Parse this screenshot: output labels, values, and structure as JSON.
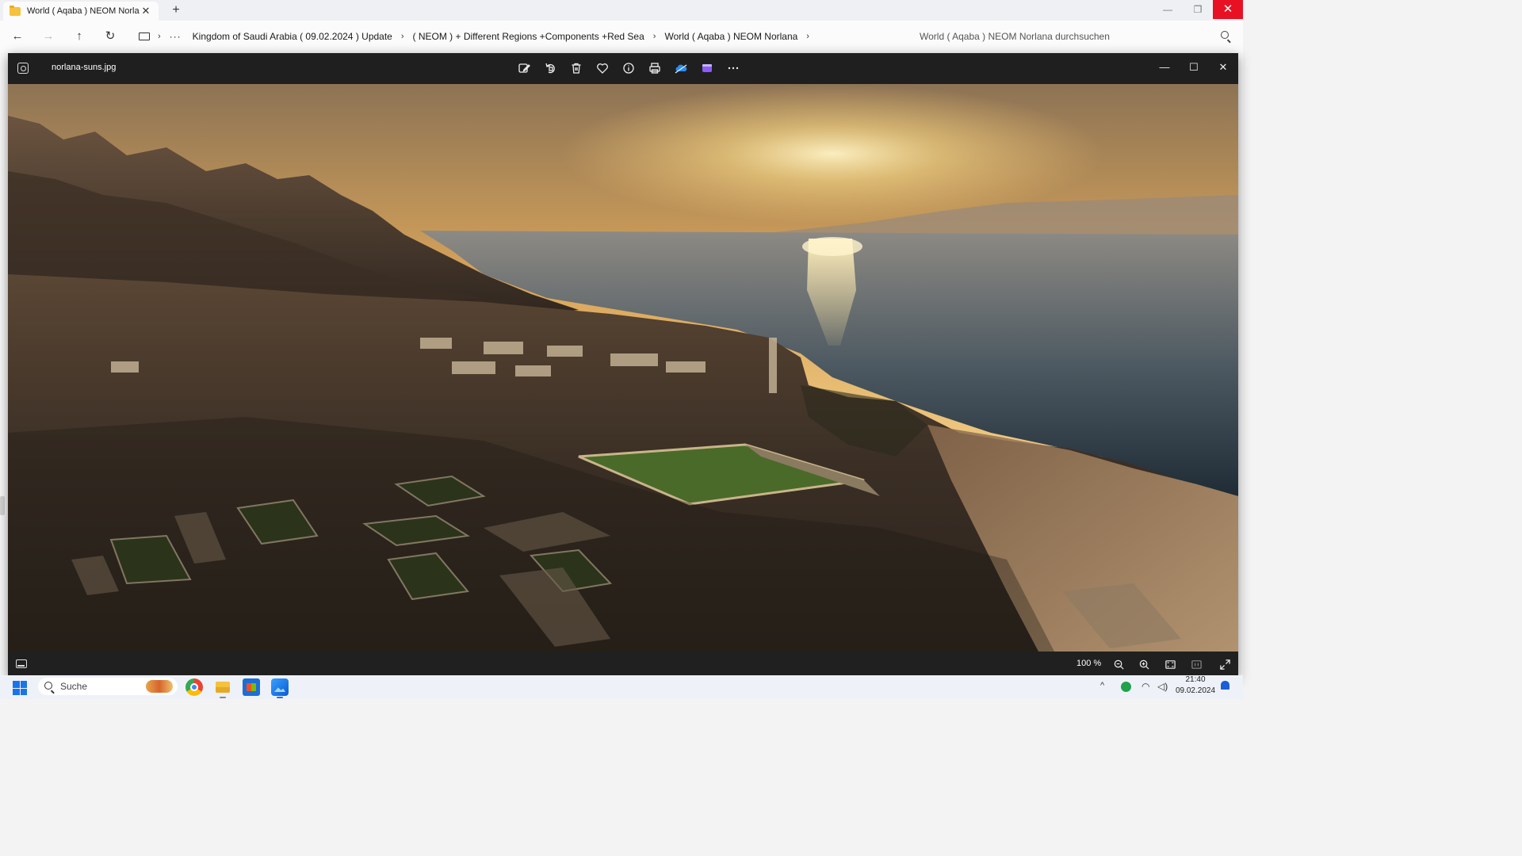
{
  "explorer": {
    "tab_title": "World ( Aqaba ) NEOM Norlan",
    "breadcrumbs": [
      "Kingdom of Saudi Arabia ( 09.02.2024 ) Update",
      "( NEOM ) + Different Regions +Components +Red Sea",
      "World ( Aqaba ) NEOM Norlana"
    ],
    "search_placeholder": "World ( Aqaba ) NEOM Norlana durchsuchen",
    "icons": [
      "folder-icon",
      "close-icon",
      "plus-icon",
      "back-icon",
      "forward-icon",
      "up-icon",
      "refresh-icon",
      "pc-icon",
      "chevron-right-icon",
      "more-icon",
      "search-icon"
    ]
  },
  "viewer": {
    "filename": "norlana-suns.jpg",
    "zoom": "100 %",
    "toolbar": [
      "edit-icon",
      "rotate-icon",
      "delete-icon",
      "favorite-icon",
      "info-icon",
      "print-icon",
      "onedrive-icon",
      "clipchamp-icon",
      "more-icon"
    ],
    "footer": [
      "filmstrip-icon",
      "zoom-out-icon",
      "zoom-in-icon",
      "fit-icon",
      "actual-size-icon",
      "fullscreen-icon"
    ],
    "photo_alt": "Aerial rendering of a coastal development at sunset"
  },
  "taskbar": {
    "search_label": "Suche",
    "time": "21:40",
    "date": "09.02.2024",
    "apps": [
      "chrome-icon",
      "file-explorer-icon",
      "store-icon",
      "photos-icon"
    ]
  },
  "colors": {
    "viewer_bg": "#202020",
    "close_red": "#e81123",
    "accent": "#1a73e8"
  }
}
